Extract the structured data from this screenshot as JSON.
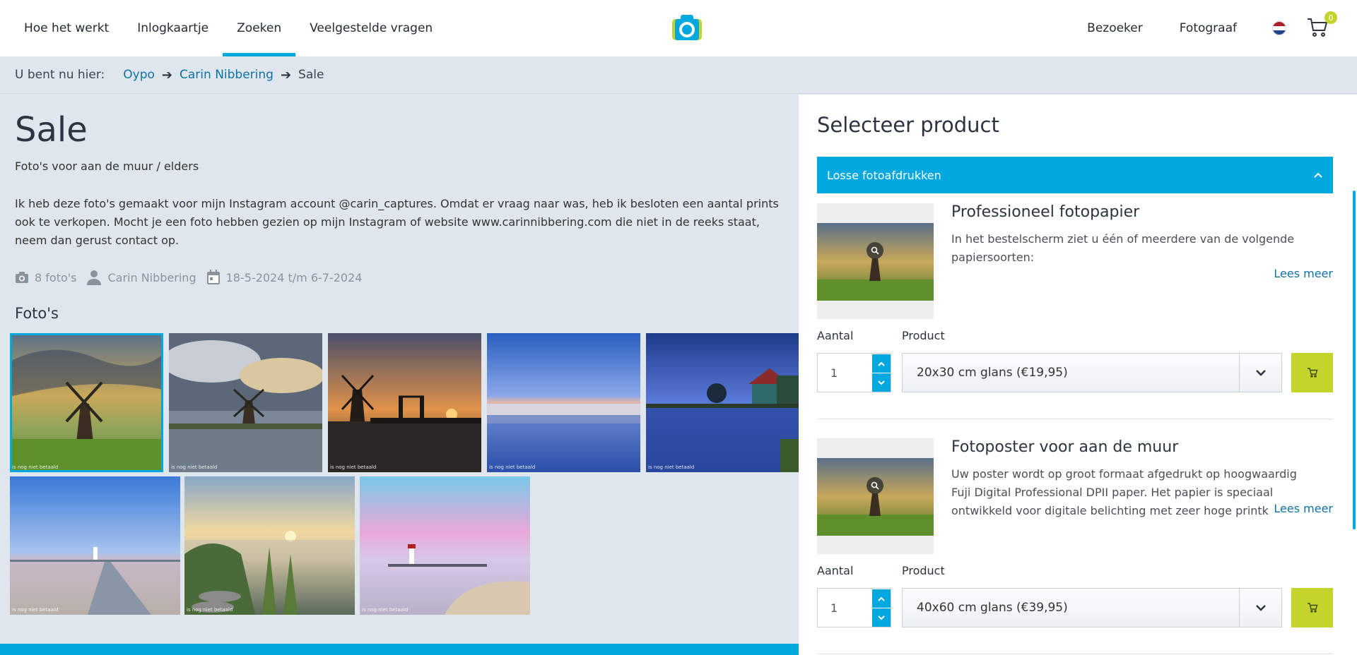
{
  "nav": {
    "left": [
      "Hoe het werkt",
      "Inlogkaartje",
      "Zoeken",
      "Veelgestelde vragen"
    ],
    "right": [
      "Bezoeker",
      "Fotograaf"
    ],
    "cart_count": "0"
  },
  "breadcrumb": {
    "prefix": "U bent nu hier:",
    "items": [
      "Oypo",
      "Carin Nibbering"
    ],
    "current": "Sale"
  },
  "album": {
    "title": "Sale",
    "subtitle": "Foto's voor aan de muur / elders",
    "description": "Ik heb deze foto's gemaakt voor mijn Instagram account @carin_captures. Omdat er vraag naar was, heb ik besloten een aantal prints ook te verkopen. Mocht je een foto hebben gezien op mijn Instagram of website www.carinnibbering.com die niet in de reeks staat, neem dan gerust contact op.",
    "photo_count": "8 foto's",
    "photographer": "Carin Nibbering",
    "dates": "18-5-2024 t/m 6-7-2024",
    "photos_heading": "Foto's",
    "watermark": "is nog niet betaald"
  },
  "panel": {
    "title": "Selecteer product",
    "category": "Losse fotoafdrukken",
    "qty_label": "Aantal",
    "product_label": "Product",
    "read_more": "Lees meer",
    "products": [
      {
        "name": "Professioneel fotopapier",
        "desc": "In het bestelscherm ziet u één of meerdere van de volgende papiersoorten:",
        "qty": "1",
        "option": "20x30 cm glans (€19,95)"
      },
      {
        "name": "Fotoposter voor aan de muur",
        "desc": "Uw poster wordt op groot formaat afgedrukt op hoogwaardig Fuji Digital Professional DPII paper. Het papier is speciaal ontwikkeld voor digitale belichting met zeer hoge printkwaliteit. Het",
        "qty": "1",
        "option": "40x60 cm glans (€39,95)"
      }
    ]
  },
  "colors": {
    "accent": "#00a8e0",
    "cart_green": "#c5d42c",
    "link": "#0f72a6"
  }
}
